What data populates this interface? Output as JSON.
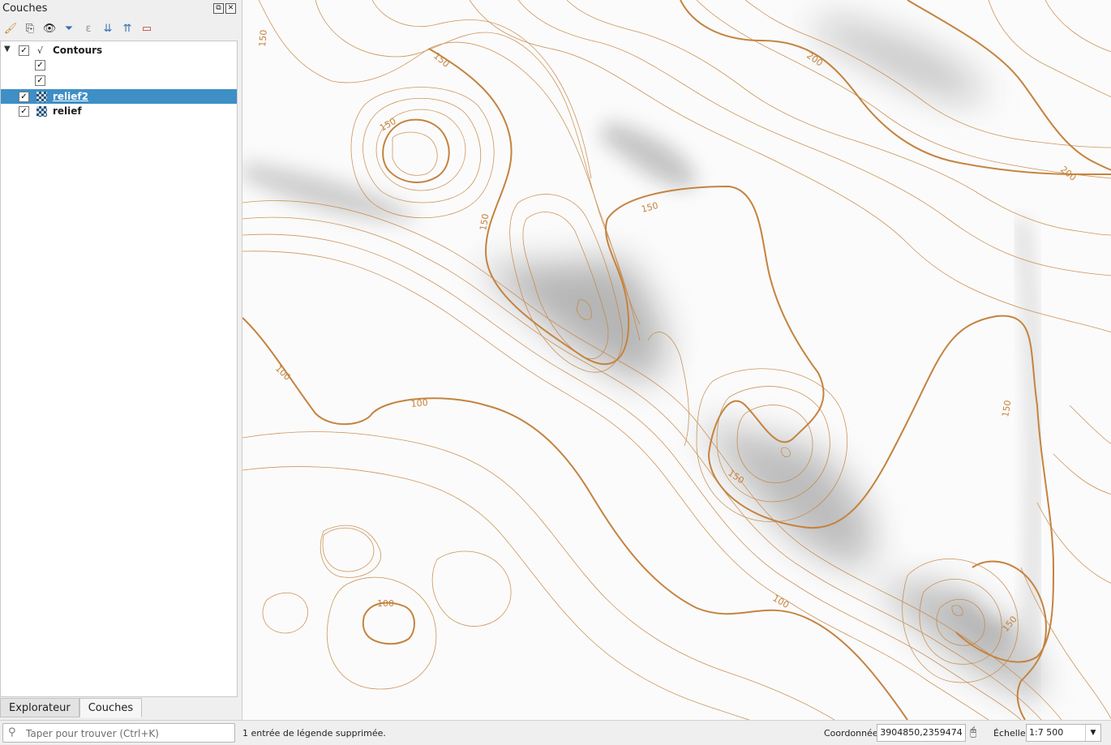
{
  "panel": {
    "title": "Couches",
    "float_btn": "⧉",
    "close_btn": "✕",
    "toolbar": [
      {
        "icon": "style-brush-icon",
        "glyph": "🖌",
        "dim": false
      },
      {
        "icon": "add-group-icon",
        "glyph": "⎘",
        "dim": false
      },
      {
        "icon": "visibility-icon",
        "glyph": "👁",
        "dim": false
      },
      {
        "icon": "filter-icon",
        "glyph": "⏷",
        "dim": false
      },
      {
        "icon": "expression-filter-icon",
        "glyph": "ε",
        "dim": true
      },
      {
        "icon": "expand-all-icon",
        "glyph": "⇊",
        "dim": false
      },
      {
        "icon": "collapse-all-icon",
        "glyph": "⇈",
        "dim": false
      },
      {
        "icon": "remove-layer-icon",
        "glyph": "▭",
        "dim": false
      }
    ],
    "layers": {
      "contours": {
        "name": "Contours",
        "checked": true
      },
      "relief2": {
        "name": "relief2",
        "checked": true
      },
      "relief": {
        "name": "relief",
        "checked": true
      }
    },
    "check_mark": "✓",
    "expand_arrow": "▼",
    "vector_glyph": "√",
    "tabs": [
      "Explorateur",
      "Couches"
    ]
  },
  "statusbar": {
    "search_placeholder": "Taper pour trouver (Ctrl+K)",
    "search_value": "",
    "message": "1 entrée de légende supprimée.",
    "coord_label": "Coordonnée",
    "coord_value": "3904850,2359474",
    "scale_label": "Échelle",
    "scale_value": "1:7 500",
    "dropdown_arrow": "▼",
    "coord_toggle_icon": "🖰"
  },
  "map": {
    "contour_color": "#c4833f",
    "labels": [
      "150",
      "150",
      "200",
      "150",
      "150",
      "150",
      "200",
      "100",
      "100",
      "150",
      "150",
      "100",
      "100",
      "150"
    ]
  }
}
